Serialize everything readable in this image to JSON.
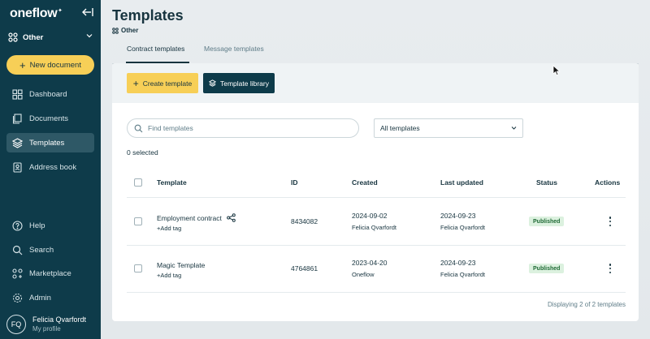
{
  "sidebar": {
    "logo": "oneflow",
    "workspace": "Other",
    "new_document": "New document",
    "nav": [
      {
        "label": "Dashboard",
        "icon": "dashboard-icon"
      },
      {
        "label": "Documents",
        "icon": "documents-icon"
      },
      {
        "label": "Templates",
        "icon": "layers-icon"
      },
      {
        "label": "Address book",
        "icon": "address-book-icon"
      }
    ],
    "bottom_nav": [
      {
        "label": "Help",
        "icon": "help-icon"
      },
      {
        "label": "Search",
        "icon": "search-icon"
      },
      {
        "label": "Marketplace",
        "icon": "marketplace-icon"
      },
      {
        "label": "Admin",
        "icon": "gear-icon"
      }
    ],
    "profile": {
      "initials": "FQ",
      "name": "Felicia Qvarfordt",
      "sub": "My profile"
    }
  },
  "header": {
    "title": "Templates",
    "workspace": "Other",
    "tabs": [
      "Contract templates",
      "Message templates"
    ]
  },
  "toolbar": {
    "create": "Create template",
    "library": "Template library"
  },
  "filters": {
    "search_placeholder": "Find templates",
    "select_value": "All templates"
  },
  "selected_count": "0 selected",
  "table": {
    "headers": [
      "Template",
      "ID",
      "Created",
      "Last updated",
      "Status",
      "Actions"
    ],
    "rows": [
      {
        "name": "Employment contract",
        "tag": "+Add tag",
        "id": "8434082",
        "created": "2024-09-02",
        "created_by": "Felicia Qvarfordt",
        "updated": "2024-09-23",
        "updated_by": "Felicia Qvarfordt",
        "status": "Published"
      },
      {
        "name": "Magic Template",
        "tag": "+Add tag",
        "id": "4764861",
        "created": "2023-04-20",
        "created_by": "Oneflow",
        "updated": "2024-09-23",
        "updated_by": "Felicia Qvarfordt",
        "status": "Published"
      }
    ],
    "footer": "Displaying 2 of 2 templates"
  },
  "colors": {
    "sidebar": "#0e3b4a",
    "accent": "#f7cf57",
    "badge_bg": "#dcf1df",
    "badge_text": "#1f6a35"
  }
}
